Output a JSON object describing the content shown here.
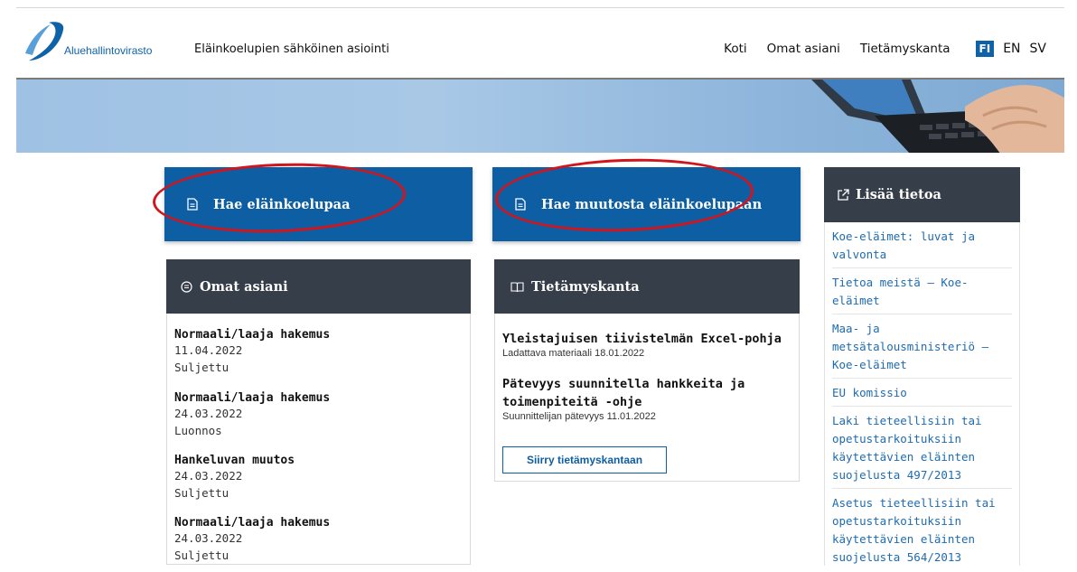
{
  "header": {
    "logo_text": "Aluehallintovirasto",
    "service_title": "Eläinkoelupien sähköinen asiointi",
    "nav": [
      {
        "label": "Koti"
      },
      {
        "label": "Omat asiani"
      },
      {
        "label": "Tietämyskanta"
      }
    ],
    "languages": [
      {
        "label": "FI",
        "active": true
      },
      {
        "label": "EN",
        "active": false
      },
      {
        "label": "SV",
        "active": false
      }
    ]
  },
  "actions": {
    "apply_label": "Hae eläinkoelupaa",
    "change_label": "Hae muutosta eläinkoelupaan"
  },
  "omat_asiani": {
    "title": "Omat asiani",
    "items": [
      {
        "title": "Normaali/laaja hakemus",
        "date": "11.04.2022",
        "status": "Suljettu"
      },
      {
        "title": "Normaali/laaja hakemus",
        "date": "24.03.2022",
        "status": "Luonnos"
      },
      {
        "title": "Hankeluvan muutos",
        "date": "24.03.2022",
        "status": "Suljettu"
      },
      {
        "title": "Normaali/laaja hakemus",
        "date": "24.03.2022",
        "status": "Suljettu"
      }
    ]
  },
  "tietamyskanta": {
    "title": "Tietämyskanta",
    "items": [
      {
        "title": "Yleistajuisen tiivistelmän Excel-pohja",
        "sub": "Ladattava materiaali 18.01.2022"
      },
      {
        "title": "Pätevyys suunnitella hankkeita ja toimenpiteitä -ohje",
        "sub": "Suunnittelijan pätevyys 11.01.2022"
      }
    ],
    "button_label": "Siirry tietämyskantaan"
  },
  "lisaa_tietoa": {
    "title": "Lisää tietoa",
    "links": [
      {
        "label": "Koe-eläimet: luvat ja valvonta"
      },
      {
        "label": "Tietoa meistä – Koe-eläimet"
      },
      {
        "label": "Maa- ja metsätalousministeriö – Koe-eläimet"
      },
      {
        "label": "EU komissio"
      },
      {
        "label": "Laki tieteellisiin tai opetustarkoituksiin käytettävien eläinten suojelusta 497/2013"
      },
      {
        "label": "Asetus tieteellisiin tai opetustarkoituksiin käytettävien eläinten suojelusta 564/2013"
      }
    ]
  },
  "colors": {
    "primary_blue": "#0e5ea3",
    "dark_header": "#363e49",
    "link": "#1e6bb0",
    "annotation_red": "#d0151c"
  }
}
